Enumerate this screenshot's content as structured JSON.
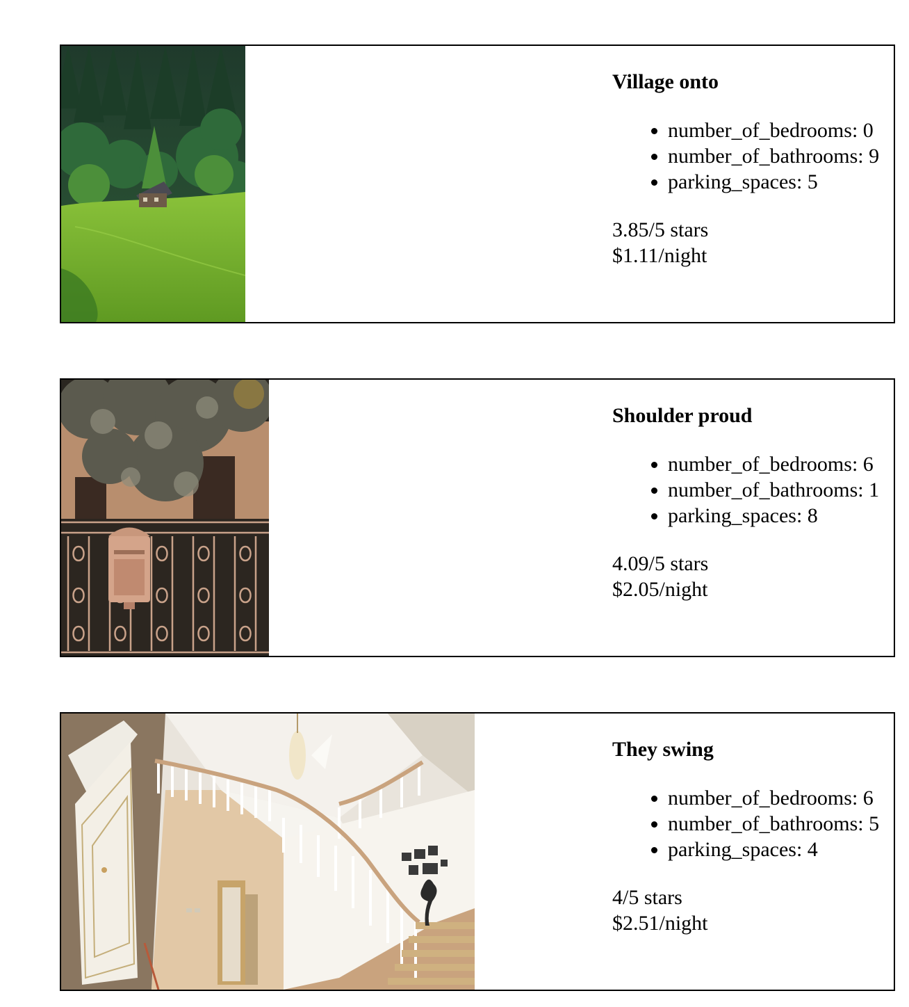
{
  "listings": [
    {
      "title": "Village onto",
      "features": [
        {
          "label": "number_of_bedrooms",
          "value": "0"
        },
        {
          "label": "number_of_bathrooms",
          "value": "9"
        },
        {
          "label": "parking_spaces",
          "value": "5"
        }
      ],
      "rating": "3.85/5 stars",
      "price": "$1.11/night"
    },
    {
      "title": "Shoulder proud",
      "features": [
        {
          "label": "number_of_bedrooms",
          "value": "6"
        },
        {
          "label": "number_of_bathrooms",
          "value": "1"
        },
        {
          "label": "parking_spaces",
          "value": "8"
        }
      ],
      "rating": "4.09/5 stars",
      "price": "$2.05/night"
    },
    {
      "title": "They swing",
      "features": [
        {
          "label": "number_of_bedrooms",
          "value": "6"
        },
        {
          "label": "number_of_bathrooms",
          "value": "5"
        },
        {
          "label": "parking_spaces",
          "value": "4"
        }
      ],
      "rating": "4/5 stars",
      "price": "$2.51/night"
    }
  ],
  "colors": {
    "border": "#000000",
    "background": "#ffffff",
    "text": "#000000"
  }
}
